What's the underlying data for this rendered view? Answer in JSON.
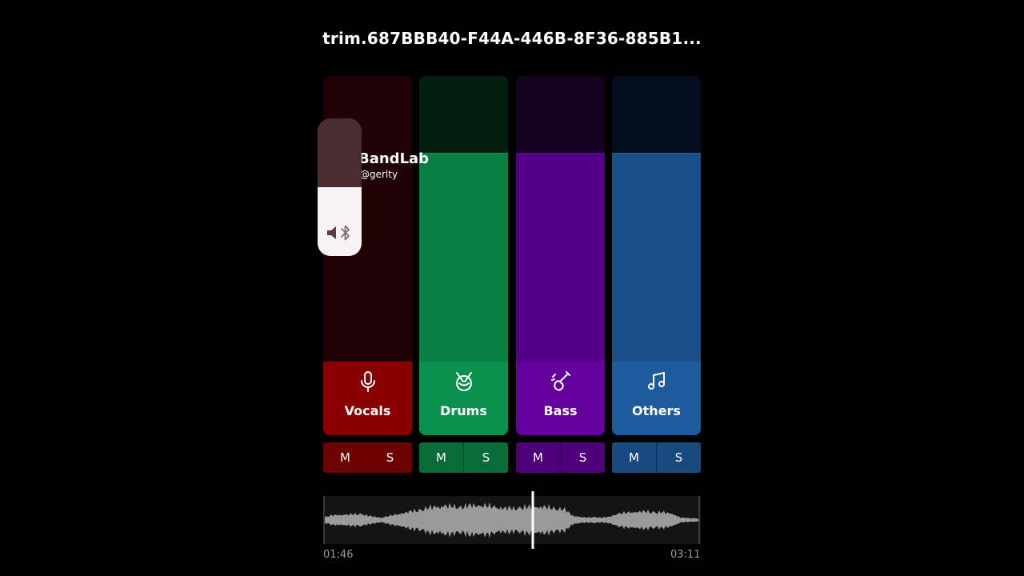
{
  "title": "trim.687BBB40-F44A-446B-8F36-885B1...",
  "watermark": {
    "brand": "BandLab",
    "handle": "@gerlty"
  },
  "volume_hud": {
    "level_fraction": 0.5,
    "icons": [
      "speaker-icon",
      "bluetooth-icon"
    ]
  },
  "stems": [
    {
      "name": "Vocals",
      "icon": "microphone-icon",
      "level_fraction": 0.0,
      "mute_label": "M",
      "solo_label": "S",
      "colors": {
        "track": "#200204",
        "fill": "#200204",
        "label": "#8a0000",
        "buttons": "#6d0000"
      }
    },
    {
      "name": "Drums",
      "icon": "drum-icon",
      "level_fraction": 0.73,
      "mute_label": "M",
      "solo_label": "S",
      "colors": {
        "track": "#021e0f",
        "fill": "#087f43",
        "label": "#0a8f4c",
        "buttons": "#086b38"
      }
    },
    {
      "name": "Bass",
      "icon": "bass-guitar-icon",
      "level_fraction": 0.73,
      "mute_label": "M",
      "solo_label": "S",
      "colors": {
        "track": "#14021e",
        "fill": "#55008c",
        "label": "#63009e",
        "buttons": "#4e007b"
      }
    },
    {
      "name": "Others",
      "icon": "music-note-icon",
      "level_fraction": 0.73,
      "mute_label": "M",
      "solo_label": "S",
      "colors": {
        "track": "#030e1f",
        "fill": "#1a4f8c",
        "label": "#1d5a9e",
        "buttons": "#184a80"
      }
    }
  ],
  "timeline": {
    "start_time": "01:46",
    "end_time": "03:11",
    "playhead_fraction": 0.555,
    "waveform_color": "#9a9a9a"
  }
}
